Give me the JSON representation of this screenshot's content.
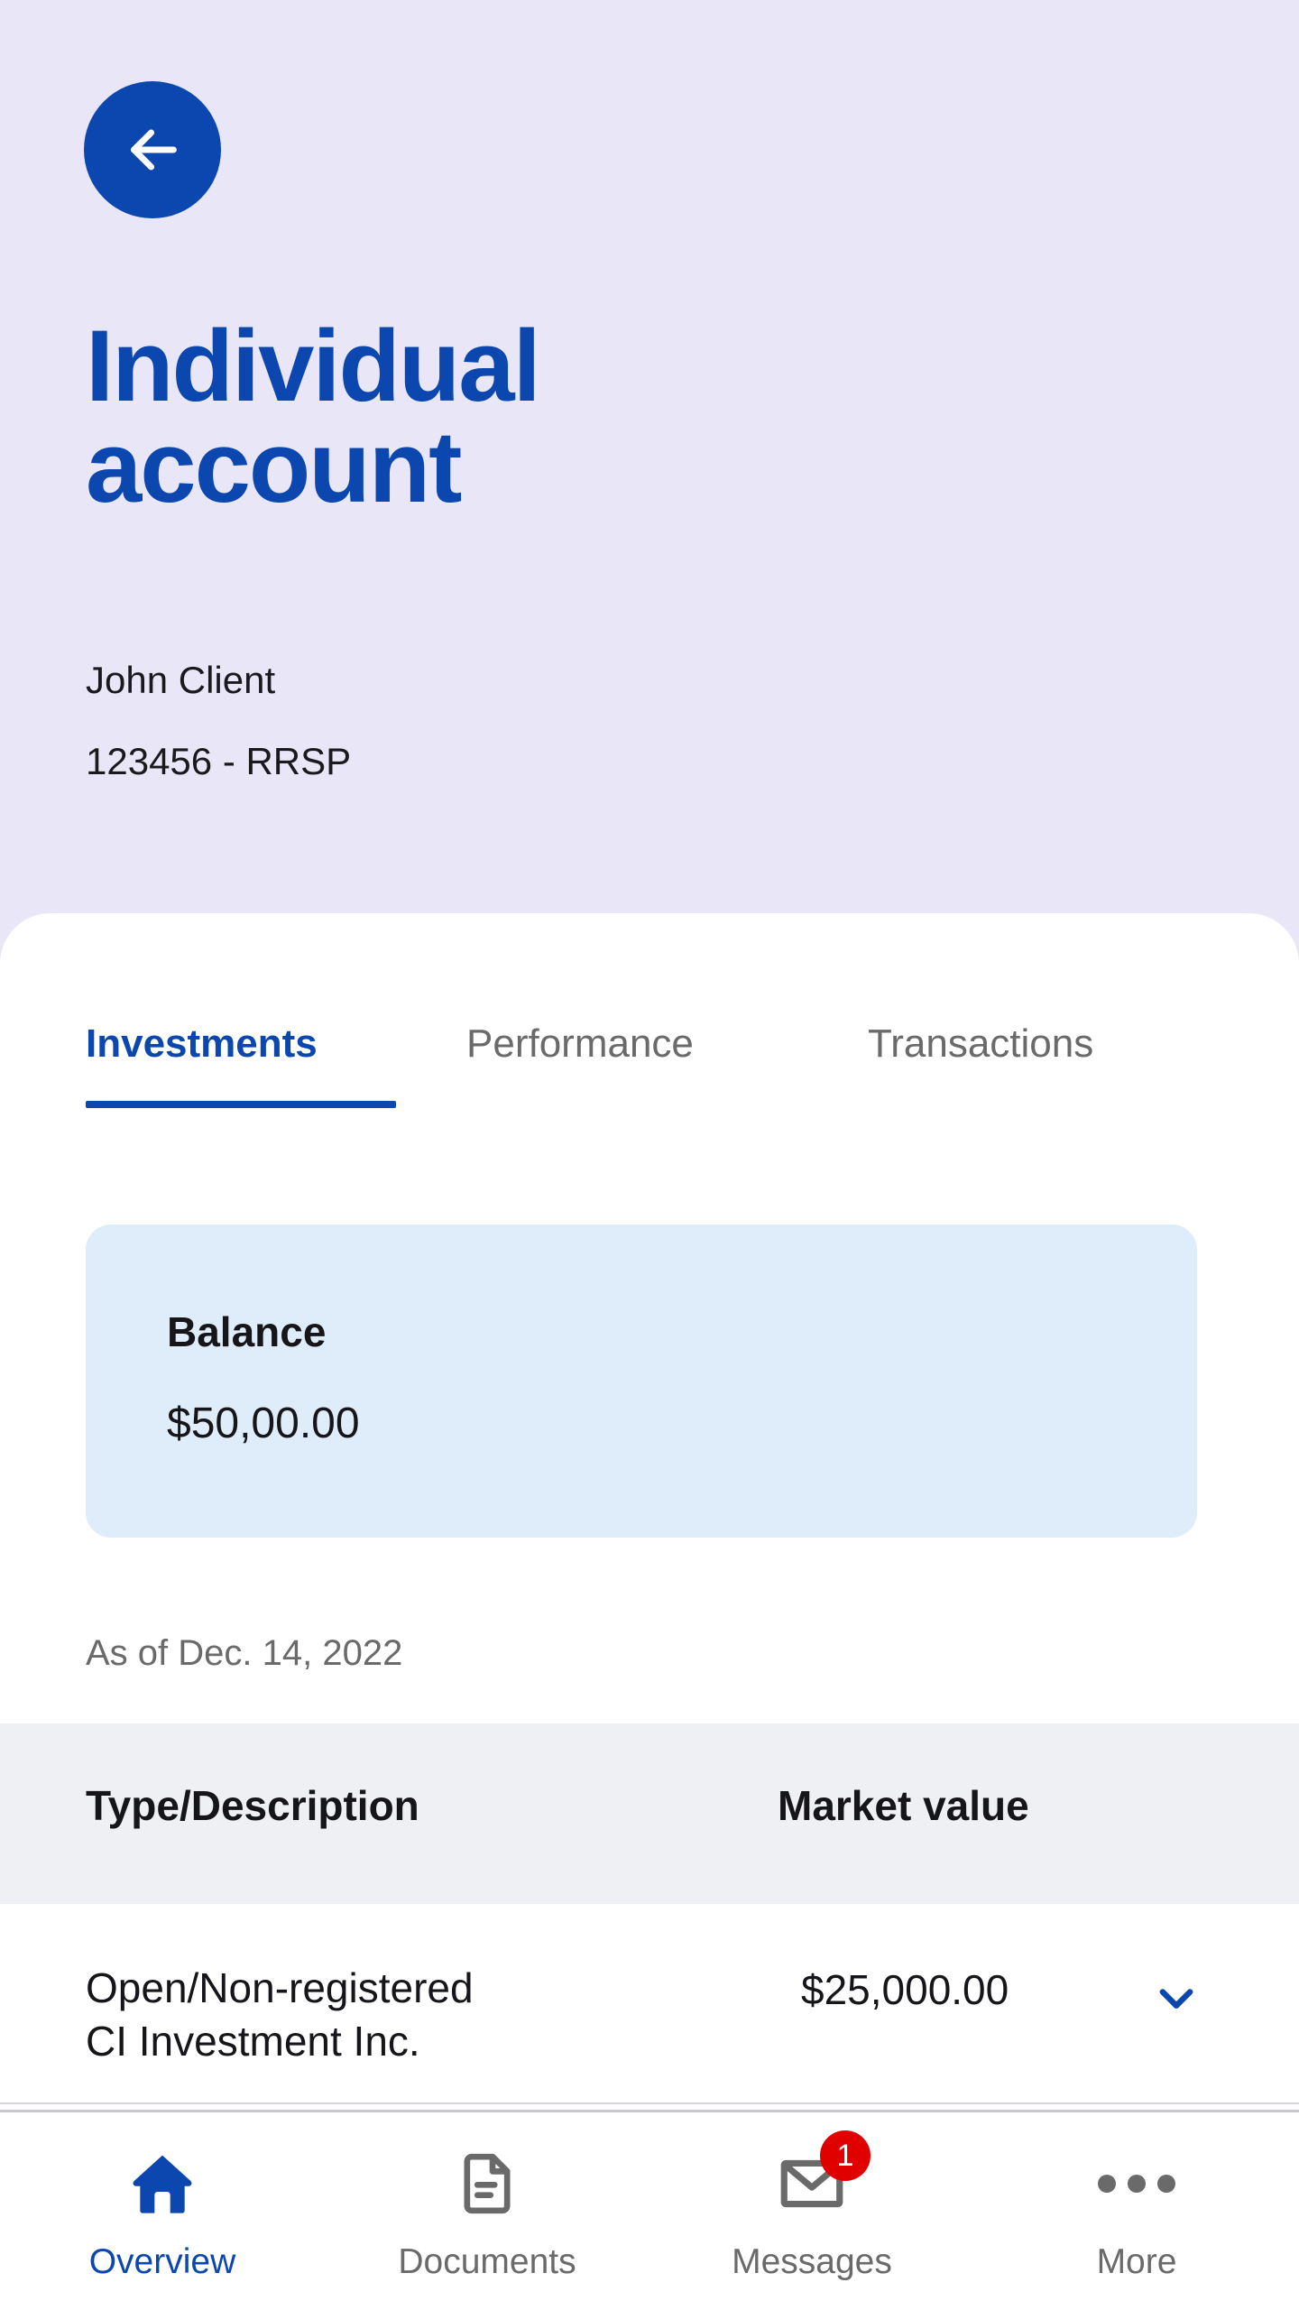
{
  "header": {
    "back_label": "Back",
    "back_icon": "arrow-left-icon",
    "title": "Individual account",
    "client_name": "John Client",
    "account_id": "123456 - RRSP",
    "background_color": "#E8E6F7",
    "brand_blue": "#0B47AE"
  },
  "tabs": {
    "items": [
      {
        "label": "Investments",
        "active": true
      },
      {
        "label": "Performance",
        "active": false
      },
      {
        "label": "Transactions",
        "active": false
      }
    ],
    "active_color": "#0B47AE",
    "inactive_color": "#6A6A6A"
  },
  "balance": {
    "label": "Balance",
    "value": "$50,00.00",
    "card_color": "#DEEDF9"
  },
  "as_of": "As of Dec. 14, 2022",
  "holdings_table": {
    "columns": [
      "Type/Description",
      "Market value"
    ],
    "rows": [
      {
        "description": "Open/Non-registered\nCI Investment Inc.",
        "market_value": "$25,000.00",
        "expand_icon": "chevron-down-icon"
      }
    ],
    "header_background": "#EFF0F3"
  },
  "bottom_nav": {
    "items": [
      {
        "label": "Overview",
        "icon": "home-icon",
        "active": true,
        "badge": null
      },
      {
        "label": "Documents",
        "icon": "document-icon",
        "active": false,
        "badge": null
      },
      {
        "label": "Messages",
        "icon": "envelope-icon",
        "active": false,
        "badge": "1"
      },
      {
        "label": "More",
        "icon": "ellipsis-icon",
        "active": false,
        "badge": null
      }
    ],
    "badge_color": "#E00000"
  }
}
